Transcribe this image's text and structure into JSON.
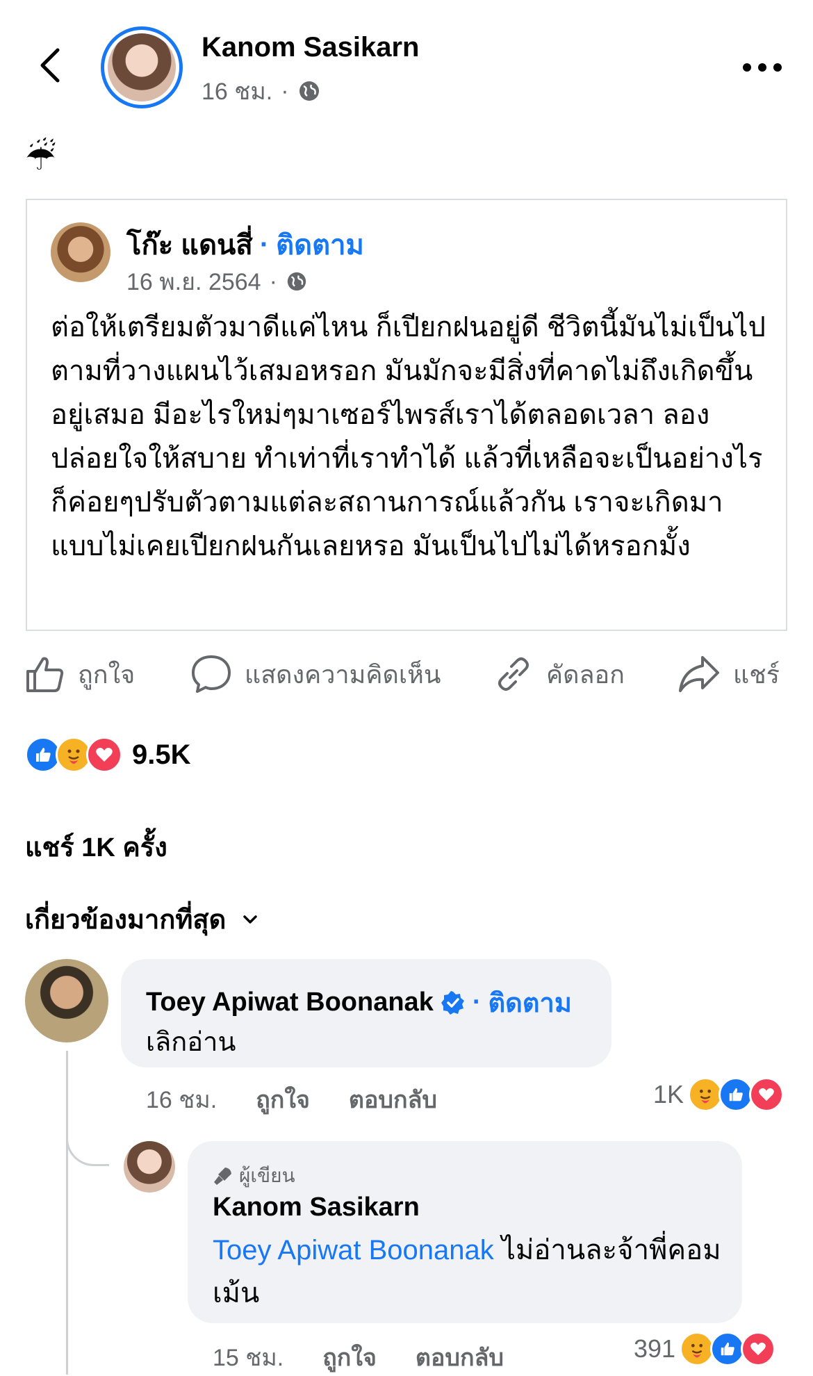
{
  "header": {
    "author": "Kanom Sasikarn",
    "time": "16 ชม.",
    "separator": "·"
  },
  "post": {
    "emoji": "☔",
    "shared": {
      "author": "โก๊ะ แดนสี่",
      "dot": "·",
      "follow": "ติดตาม",
      "date": "16 พ.ย. 2564",
      "separator": "·",
      "text": "ต่อให้เตรียมตัวมาดีแค่ไหน ก็เปียกฝนอยู่ดี ชีวิตนี้มันไม่เป็นไปตามที่วางแผนไว้เสมอหรอก มันมักจะมีสิ่งที่คาดไม่ถึงเกิดขึ้นอยู่เสมอ มีอะไรใหม่ๆมาเซอร์ไพรส์เราได้ตลอดเวลา ลองปล่อยใจให้สบาย ทำเท่าที่เราทำได้ แล้วที่เหลือจะเป็นอย่างไรก็ค่อยๆปรับตัวตามแต่ละสถานการณ์แล้วกัน เราจะเกิดมาแบบไม่เคยเปียกฝนกันเลยหรอ มันเป็นไปไม่ได้หรอกมั้ง"
    }
  },
  "actions": {
    "like": "ถูกใจ",
    "comment": "แสดงความคิดเห็น",
    "copy": "คัดลอก",
    "share": "แชร์"
  },
  "stats": {
    "reactions": "9.5K",
    "shares": "แชร์ 1K ครั้ง"
  },
  "sort": {
    "label": "เกี่ยวข้องมากที่สุด"
  },
  "comments": [
    {
      "name": "Toey Apiwat Boonanak",
      "dot": "·",
      "follow": "ติดตาม",
      "text": "เลิกอ่าน",
      "time": "16 ชม.",
      "like": "ถูกใจ",
      "reply": "ตอบกลับ",
      "reaction_count": "1K"
    }
  ],
  "reply": {
    "badge": "ผู้เขียน",
    "name": "Kanom Sasikarn",
    "mention": "Toey Apiwat Boonanak",
    "text": " ไม่อ่านละจ้าพี่คอมเม้น",
    "time": "15 ชม.",
    "like": "ถูกใจ",
    "reply": "ตอบกลับ",
    "reaction_count": "391"
  },
  "colors": {
    "accent": "#1877f2",
    "love": "#f33e58",
    "care": "#f7b125"
  }
}
